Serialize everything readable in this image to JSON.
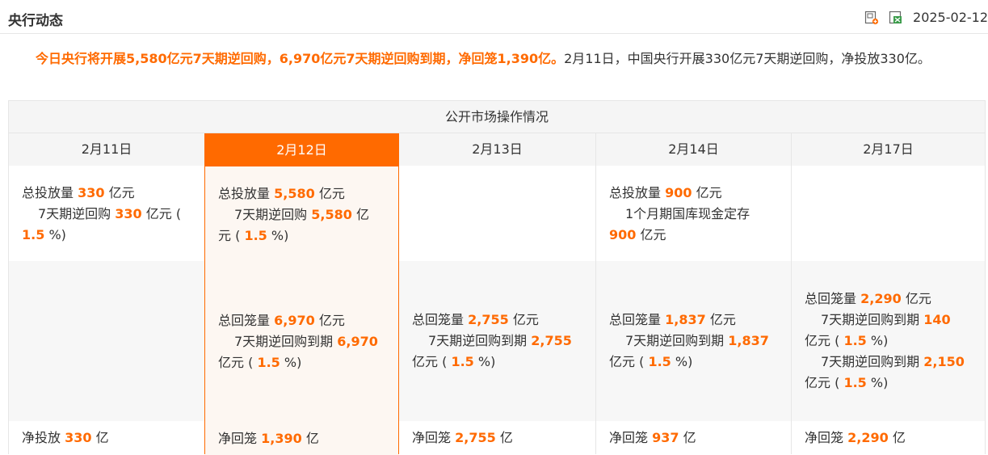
{
  "header": {
    "title": "央行动态",
    "date": "2025-02-12",
    "icons": [
      "image-export-icon",
      "excel-export-icon"
    ]
  },
  "summary": {
    "highlight": "今日央行将开展5,580亿元7天期逆回购，6,970亿元7天期逆回购到期，净回笼1,390亿。",
    "text": "2月11日，中国央行开展330亿元7天期逆回购，净投放330亿。"
  },
  "table": {
    "title": "公开市场操作情况",
    "labels": {
      "total_injection": "总投放量",
      "total_withdrawal": "总回笼量",
      "unit_yiyuan": "亿元",
      "unit_yi": "亿",
      "net_injection": "净投放",
      "net_withdrawal": "净回笼",
      "repo_7d": "7天期逆回购",
      "repo_7d_maturity": "7天期逆回购到期",
      "treasury_deposit_1m": "1个月期国库现金定存",
      "rate_open": "(",
      "rate_close": "%)"
    },
    "columns": [
      {
        "date": "2月11日",
        "injection": {
          "total": "330",
          "items": [
            {
              "amount": "330",
              "rate": "1.5"
            }
          ]
        },
        "withdrawal": null,
        "net": {
          "amount": "330"
        }
      },
      {
        "date": "2月12日",
        "active": true,
        "injection": {
          "total": "5,580",
          "items": [
            {
              "amount": "5,580",
              "rate": "1.5"
            }
          ]
        },
        "withdrawal": {
          "total": "6,970",
          "items": [
            {
              "amount": "6,970",
              "rate": "1.5"
            }
          ]
        },
        "net": {
          "amount": "1,390"
        }
      },
      {
        "date": "2月13日",
        "injection": null,
        "withdrawal": {
          "total": "2,755",
          "items": [
            {
              "amount": "2,755",
              "rate": "1.5"
            }
          ]
        },
        "net": {
          "amount": "2,755"
        }
      },
      {
        "date": "2月14日",
        "injection": {
          "total": "900",
          "items": [
            {
              "amount": "900"
            }
          ]
        },
        "withdrawal": {
          "total": "1,837",
          "items": [
            {
              "amount": "1,837",
              "rate": "1.5"
            }
          ]
        },
        "net": {
          "amount": "937"
        }
      },
      {
        "date": "2月17日",
        "injection": null,
        "withdrawal": {
          "total": "2,290",
          "items": [
            {
              "amount": "140",
              "rate": "1.5"
            },
            {
              "amount": "2,150",
              "rate": "1.5"
            }
          ]
        },
        "net": {
          "amount": "2,290"
        }
      }
    ]
  },
  "colors": {
    "accent": "#ff6a00",
    "header_bg": "#f5f5f5",
    "active_bg": "#fdf7f2"
  }
}
